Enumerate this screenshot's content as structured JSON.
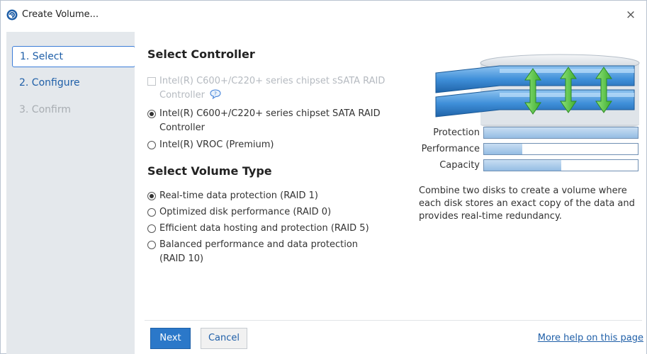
{
  "window": {
    "title": "Create Volume...",
    "icon": "intel-rst-icon",
    "close_label": "×"
  },
  "sidebar": {
    "steps": [
      {
        "label": "1. Select",
        "state": "active"
      },
      {
        "label": "2. Configure",
        "state": "enabled"
      },
      {
        "label": "3. Confirm",
        "state": "disabled"
      }
    ]
  },
  "controller": {
    "title": "Select Controller",
    "options": [
      {
        "label_line1": "Intel(R) C600+/C220+ series chipset sSATA RAID",
        "label_line2": "Controller",
        "selected": false,
        "disabled": true,
        "info_icon": "info-balloon-icon"
      },
      {
        "label_line1": "Intel(R) C600+/C220+ series chipset SATA RAID",
        "label_line2": "Controller",
        "selected": true,
        "disabled": false
      },
      {
        "label_line1": "Intel(R) VROC (Premium)",
        "label_line2": "",
        "selected": false,
        "disabled": false
      }
    ]
  },
  "volume_type": {
    "title": "Select Volume Type",
    "options": [
      {
        "label_line1": "Real-time data protection (RAID 1)",
        "label_line2": "",
        "selected": true
      },
      {
        "label_line1": "Optimized disk performance (RAID 0)",
        "label_line2": "",
        "selected": false
      },
      {
        "label_line1": "Efficient data hosting and protection (RAID 5)",
        "label_line2": "",
        "selected": false
      },
      {
        "label_line1": "Balanced performance and data protection",
        "label_line2": "(RAID 10)",
        "selected": false
      }
    ]
  },
  "meters": [
    {
      "label": "Protection",
      "value_pct": 100
    },
    {
      "label": "Performance",
      "value_pct": 25
    },
    {
      "label": "Capacity",
      "value_pct": 50
    }
  ],
  "description": "Combine two disks to create a volume where each disk stores an exact copy of the data and provides real-time redundancy.",
  "buttons": {
    "next": "Next",
    "cancel": "Cancel"
  },
  "help_link": "More help on this page",
  "colors": {
    "accent": "#2b78c9",
    "link": "#1f5fa8",
    "sidebar_bg": "#e4e8ec",
    "meter_fill": "#95bde3",
    "arrow_green": "#58c24a"
  }
}
